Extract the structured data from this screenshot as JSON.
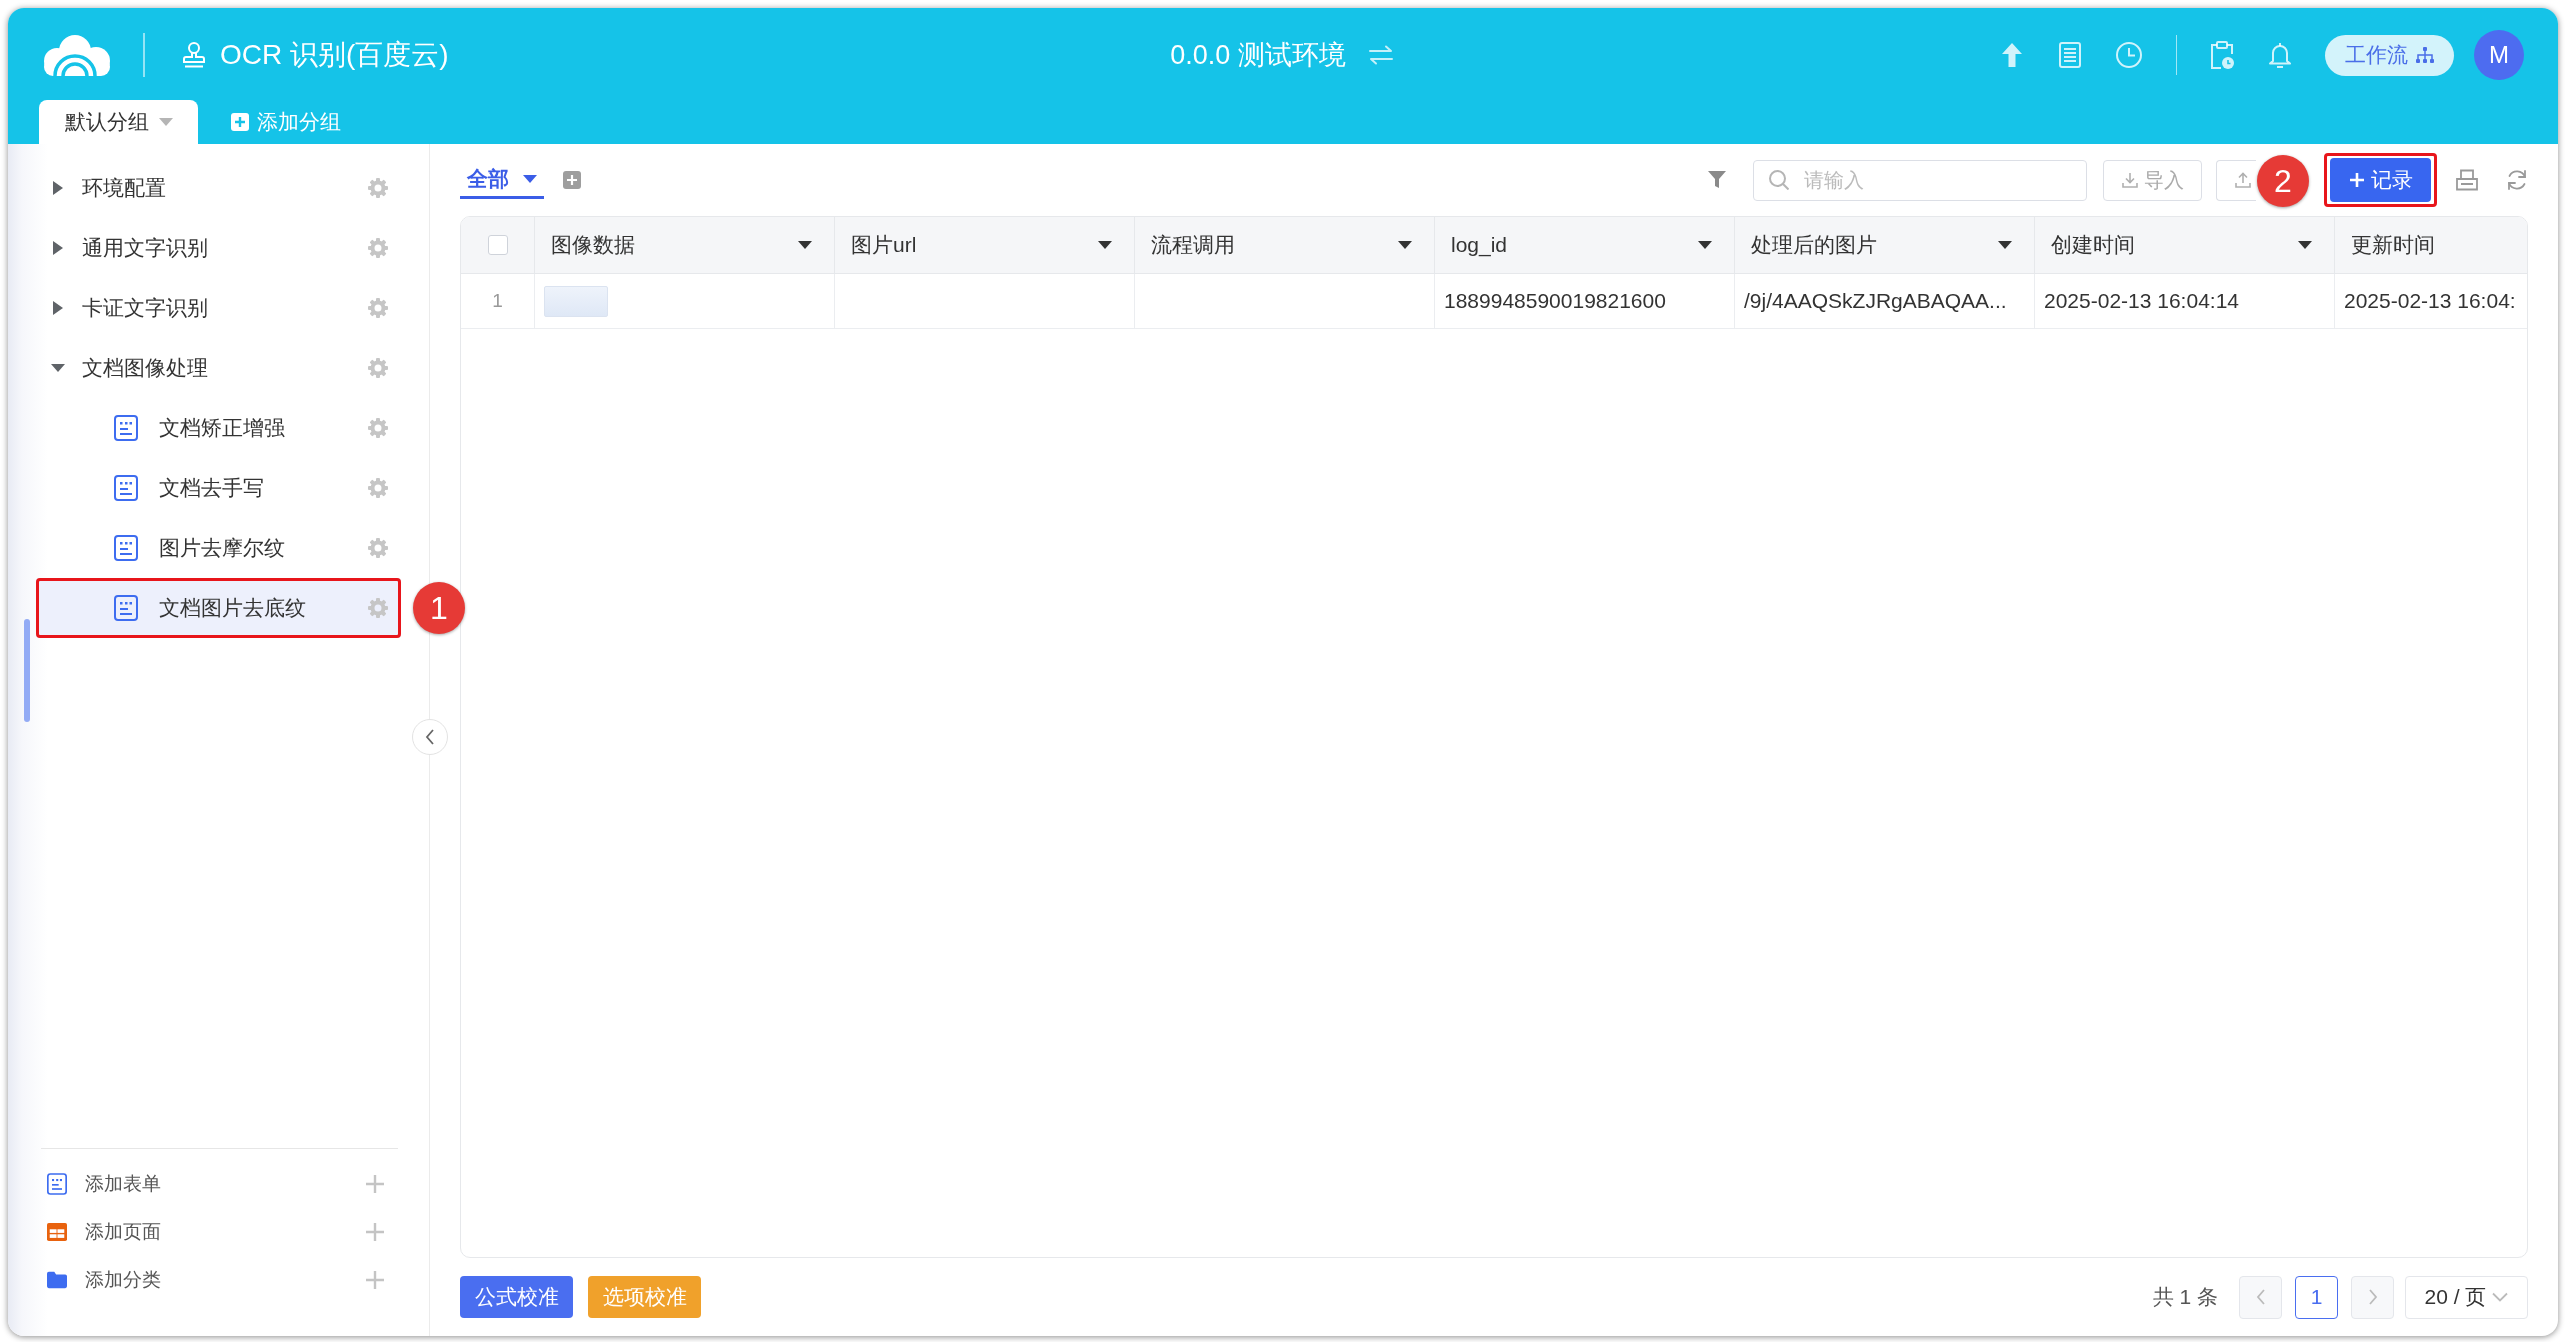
{
  "header": {
    "title": "OCR 识别(百度云)",
    "environment": "0.0.0 测试环境",
    "workflow_button": "工作流",
    "avatar": "M"
  },
  "group_tabs": [
    {
      "label": "默认分组",
      "selected": true
    }
  ],
  "add_group": "添加分组",
  "sidebar": {
    "items": [
      {
        "kind": "folder",
        "label": "环境配置",
        "expanded": false,
        "selected": false
      },
      {
        "kind": "folder",
        "label": "通用文字识别",
        "expanded": false,
        "selected": false
      },
      {
        "kind": "folder",
        "label": "卡证文字识别",
        "expanded": false,
        "selected": false
      },
      {
        "kind": "folder",
        "label": "文档图像处理",
        "expanded": true,
        "selected": false,
        "children": [
          {
            "kind": "form",
            "label": "文档矫正增强",
            "selected": false
          },
          {
            "kind": "form",
            "label": "文档去手写",
            "selected": false
          },
          {
            "kind": "form",
            "label": "图片去摩尔纹",
            "selected": false
          },
          {
            "kind": "form",
            "label": "文档图片去底纹",
            "selected": true,
            "callout": "1"
          }
        ]
      }
    ],
    "add_actions": [
      {
        "kind": "form",
        "label": "添加表单"
      },
      {
        "kind": "page",
        "label": "添加页面"
      },
      {
        "kind": "category",
        "label": "添加分类"
      }
    ]
  },
  "view_tabs": [
    {
      "label": "全部",
      "selected": true
    }
  ],
  "toolbar": {
    "search": {
      "placeholder": "请输入"
    },
    "import_button": "导入",
    "add_button": {
      "label": "记录",
      "callout": "2"
    }
  },
  "table": {
    "select_all": {
      "checked": false
    },
    "columns": [
      {
        "label": "图像数据",
        "dropdown": true
      },
      {
        "label": "图片url",
        "dropdown": true
      },
      {
        "label": "流程调用",
        "dropdown": true
      },
      {
        "label": "log_id",
        "dropdown": true
      },
      {
        "label": "处理后的图片",
        "dropdown": true
      },
      {
        "label": "创建时间",
        "dropdown": true
      },
      {
        "label": "更新时间",
        "dropdown": false
      }
    ],
    "rows": [
      {
        "index": "1",
        "cells": [
          {
            "kind": "image"
          },
          {
            "kind": "empty"
          },
          {
            "kind": "empty"
          },
          {
            "kind": "text",
            "text": "1889948590019821600"
          },
          {
            "kind": "text",
            "text": "/9j/4AAQSkZJRgABAQAA..."
          },
          {
            "kind": "text",
            "text": "2025-02-13 16:04:14"
          },
          {
            "kind": "text",
            "text": "2025-02-13 16:04:"
          }
        ]
      }
    ]
  },
  "footer": {
    "actions": [
      {
        "label": "公式校准",
        "color": "#4a6ef0"
      },
      {
        "label": "选项校准",
        "color": "#f0a12b"
      }
    ],
    "pagination": {
      "total": "共 1 条",
      "pages": [
        {
          "label": "1",
          "selected": true
        }
      ],
      "page_size": "20 / 页"
    }
  }
}
